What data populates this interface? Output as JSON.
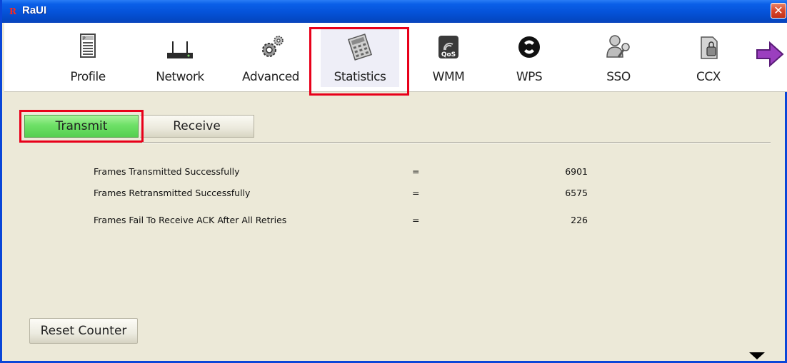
{
  "window": {
    "title": "RaUI",
    "app_icon": "R",
    "close_glyph": "✕"
  },
  "toolbar": {
    "items": [
      {
        "label": "Profile",
        "icon": "profile-icon"
      },
      {
        "label": "Network",
        "icon": "network-icon"
      },
      {
        "label": "Advanced",
        "icon": "advanced-icon"
      },
      {
        "label": "Statistics",
        "icon": "statistics-icon",
        "selected": true
      },
      {
        "label": "WMM",
        "icon": "wmm-qos-icon"
      },
      {
        "label": "WPS",
        "icon": "wps-icon"
      },
      {
        "label": "SSO",
        "icon": "sso-icon"
      },
      {
        "label": "CCX",
        "icon": "ccx-icon"
      }
    ],
    "next_icon": "arrow-right-icon",
    "wmm_badge": "QoS"
  },
  "tabs": [
    {
      "label": "Transmit",
      "selected": true
    },
    {
      "label": "Receive",
      "selected": false
    }
  ],
  "stats": [
    {
      "label": "Frames Transmitted Successfully",
      "sep": "=",
      "value": "6901"
    },
    {
      "label": "Frames Retransmitted Successfully",
      "sep": "=",
      "value": "6575"
    },
    {
      "label": "Frames Fail To Receive ACK After All Retries",
      "sep": "=",
      "value": "226"
    }
  ],
  "reset_label": "Reset Counter",
  "colors": {
    "highlight": "#e8001a",
    "transmit_tab": "#6ee067",
    "titlebar": "#0552d8"
  }
}
